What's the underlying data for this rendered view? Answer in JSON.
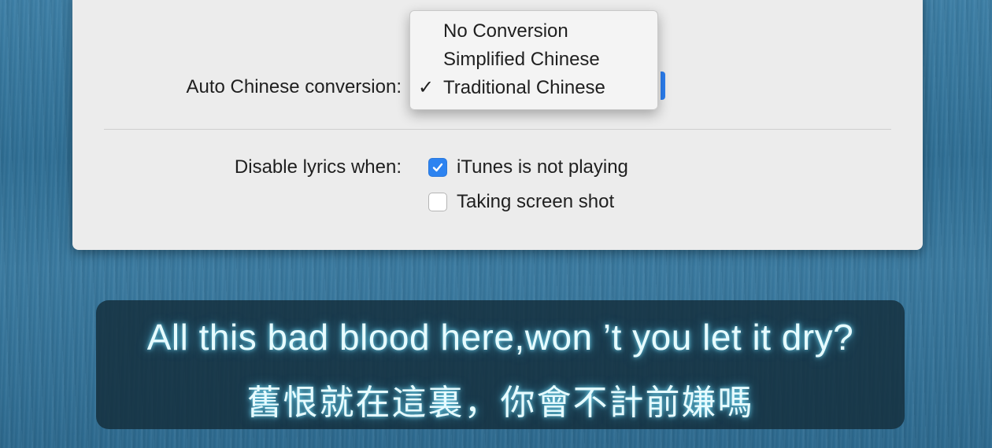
{
  "preferences": {
    "chinese_conversion_label": "Auto Chinese conversion:",
    "conversion_menu": {
      "items": [
        {
          "label": "No Conversion",
          "checked": false
        },
        {
          "label": "Simplified Chinese",
          "checked": false
        },
        {
          "label": "Traditional Chinese",
          "checked": true
        }
      ],
      "check_glyph": "✓"
    },
    "disable_lyrics_label": "Disable lyrics when:",
    "options": [
      {
        "label": "iTunes is not playing",
        "checked": true
      },
      {
        "label": "Taking screen shot",
        "checked": false
      }
    ]
  },
  "lyrics": {
    "line_english": "All this bad blood here,won ’t you let it dry?",
    "line_chinese": "舊恨就在這裏，你會不計前嫌嗎"
  },
  "colors": {
    "accent": "#2d83f0",
    "panel_bg": "#ececec",
    "lyric_glow": "#78e6ff"
  }
}
